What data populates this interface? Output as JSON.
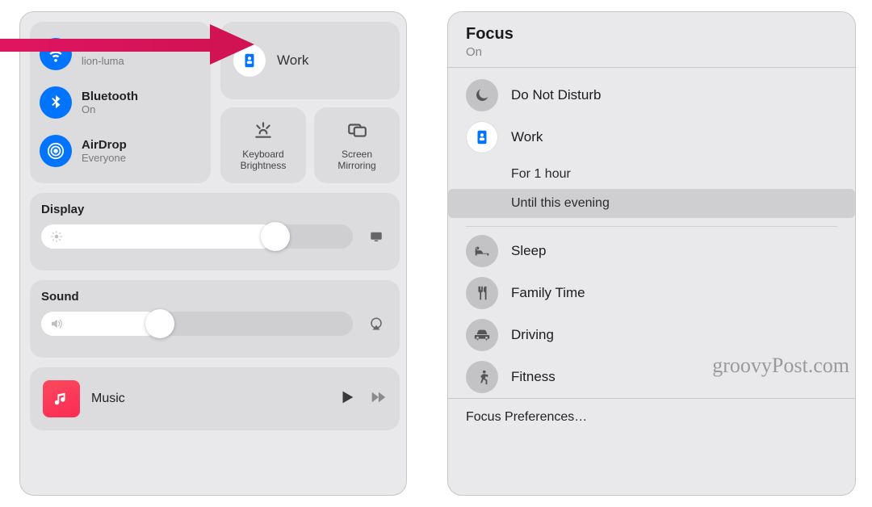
{
  "control_center": {
    "connectivity": {
      "wifi": {
        "label": "Wi-Fi",
        "status": "lion-luma"
      },
      "bluetooth": {
        "label": "Bluetooth",
        "status": "On"
      },
      "airdrop": {
        "label": "AirDrop",
        "status": "Everyone"
      }
    },
    "focus_tile": {
      "label": "Work"
    },
    "keyboard_brightness": {
      "label": "Keyboard\nBrightness"
    },
    "screen_mirroring": {
      "label": "Screen\nMirroring"
    },
    "display": {
      "title": "Display",
      "value_pct": 75
    },
    "sound": {
      "title": "Sound",
      "value_pct": 38
    },
    "music": {
      "title": "Music"
    }
  },
  "focus_panel": {
    "title": "Focus",
    "status": "On",
    "modes": [
      {
        "id": "dnd",
        "label": "Do Not Disturb",
        "active": false,
        "icon": "moon"
      },
      {
        "id": "work",
        "label": "Work",
        "active": true,
        "icon": "badge",
        "duration_options": [
          {
            "label": "For 1 hour",
            "selected": false
          },
          {
            "label": "Until this evening",
            "selected": true
          }
        ]
      },
      {
        "id": "sleep",
        "label": "Sleep",
        "active": false,
        "icon": "bed"
      },
      {
        "id": "family",
        "label": "Family Time",
        "active": false,
        "icon": "fork"
      },
      {
        "id": "driving",
        "label": "Driving",
        "active": false,
        "icon": "car"
      },
      {
        "id": "fitness",
        "label": "Fitness",
        "active": false,
        "icon": "runner"
      }
    ],
    "preferences_label": "Focus Preferences…"
  },
  "watermark": "groovyPost.com"
}
